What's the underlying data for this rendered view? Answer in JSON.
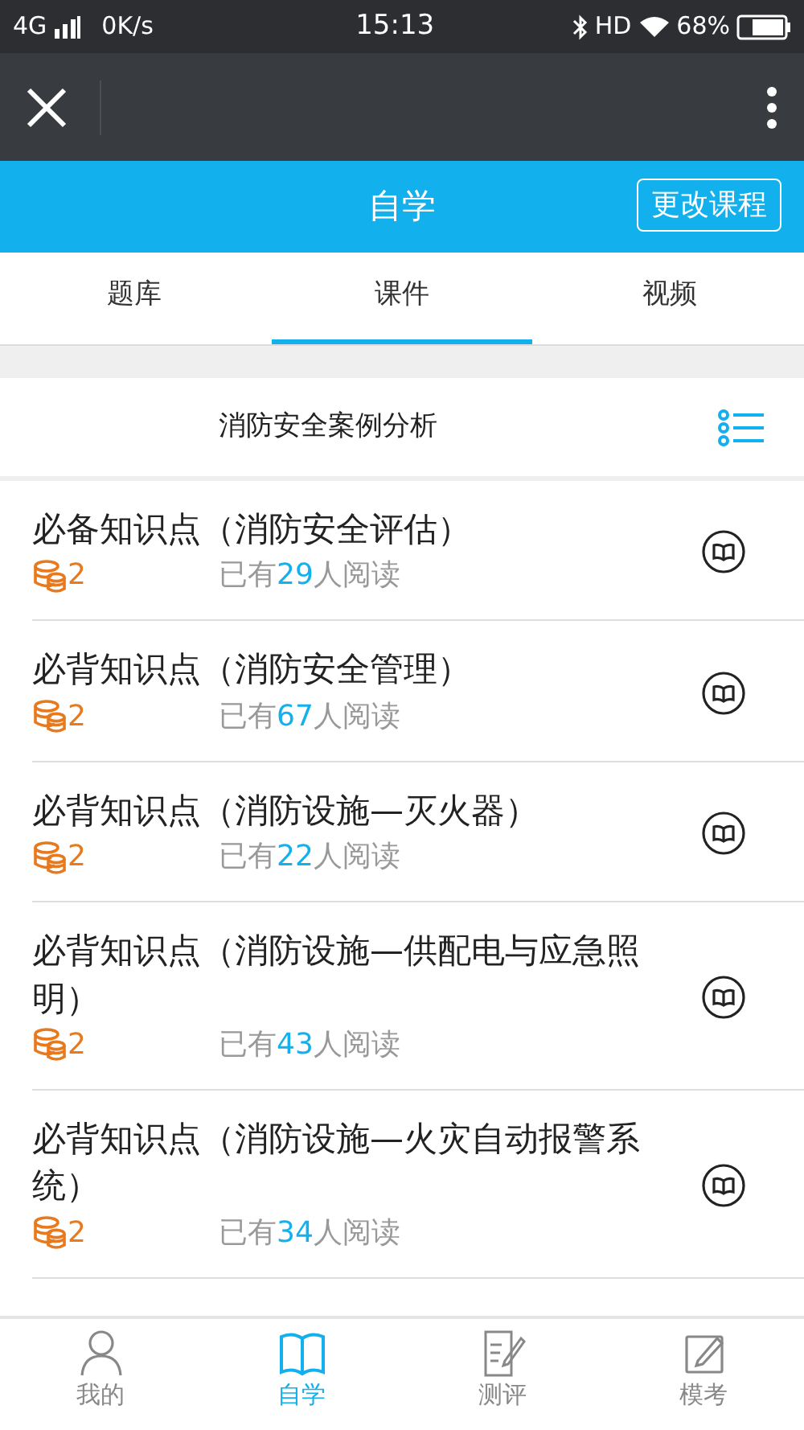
{
  "status_bar": {
    "network": "4G",
    "speed": "0K/s",
    "time": "15:13",
    "hd": "HD",
    "battery": "68%"
  },
  "header": {
    "title": "自学",
    "action": "更改课程"
  },
  "tabs": [
    {
      "label": "题库",
      "selected": false
    },
    {
      "label": "课件",
      "selected": true
    },
    {
      "label": "视频",
      "selected": false
    }
  ],
  "section": {
    "title": "消防安全案例分析"
  },
  "items": [
    {
      "title": "必备知识点（消防安全评估）",
      "coins": "2",
      "read_prefix": "已有",
      "read_count": "29",
      "read_suffix": "人阅读"
    },
    {
      "title": "必背知识点（消防安全管理）",
      "coins": "2",
      "read_prefix": "已有",
      "read_count": "67",
      "read_suffix": "人阅读"
    },
    {
      "title": "必背知识点（消防设施—灭火器）",
      "coins": "2",
      "read_prefix": "已有",
      "read_count": "22",
      "read_suffix": "人阅读"
    },
    {
      "title": "必背知识点（消防设施—供配电与应急照明）",
      "coins": "2",
      "read_prefix": "已有",
      "read_count": "43",
      "read_suffix": "人阅读"
    },
    {
      "title": "必背知识点（消防设施—火灾自动报警系统）",
      "coins": "2",
      "read_prefix": "已有",
      "read_count": "34",
      "read_suffix": "人阅读"
    }
  ],
  "bottom_nav": [
    {
      "label": "我的",
      "kind": "person",
      "selected": false
    },
    {
      "label": "自学",
      "kind": "book",
      "selected": true
    },
    {
      "label": "测评",
      "kind": "test",
      "selected": false
    },
    {
      "label": "模考",
      "kind": "edit",
      "selected": false
    }
  ]
}
